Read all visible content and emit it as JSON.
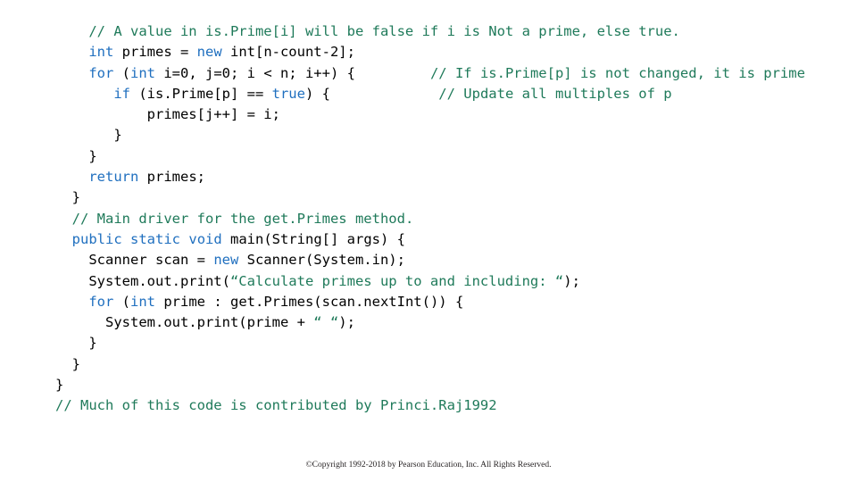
{
  "slide": {
    "code_lines": [
      [
        {
          "t": "    ",
          "c": "plain"
        },
        {
          "t": "// A value in is.Prime[i] will be false if i is Not a prime, else true.",
          "c": "cmt"
        }
      ],
      [
        {
          "t": "    ",
          "c": "plain"
        },
        {
          "t": "int",
          "c": "kw"
        },
        {
          "t": " primes = ",
          "c": "plain"
        },
        {
          "t": "new",
          "c": "kw"
        },
        {
          "t": " int[n-count-2];",
          "c": "plain"
        }
      ],
      [
        {
          "t": "    ",
          "c": "plain"
        },
        {
          "t": "for",
          "c": "kw"
        },
        {
          "t": " (",
          "c": "plain"
        },
        {
          "t": "int",
          "c": "kw"
        },
        {
          "t": " i=0, j=0; i < n; i++) {",
          "c": "plain"
        },
        {
          "t": "         ",
          "c": "plain"
        },
        {
          "t": "// If is.Prime[p] is not changed, it is prime",
          "c": "cmt"
        }
      ],
      [
        {
          "t": "       ",
          "c": "plain"
        },
        {
          "t": "if",
          "c": "kw"
        },
        {
          "t": " (is.Prime[p] == ",
          "c": "plain"
        },
        {
          "t": "true",
          "c": "kw"
        },
        {
          "t": ") {",
          "c": "plain"
        },
        {
          "t": "             ",
          "c": "plain"
        },
        {
          "t": "// Update all multiples of p",
          "c": "cmt"
        }
      ],
      [
        {
          "t": "           primes[j++] = i;",
          "c": "plain"
        }
      ],
      [
        {
          "t": "       }",
          "c": "plain"
        }
      ],
      [
        {
          "t": "    }",
          "c": "plain"
        }
      ],
      [
        {
          "t": "    ",
          "c": "plain"
        },
        {
          "t": "return",
          "c": "kw"
        },
        {
          "t": " primes;",
          "c": "plain"
        }
      ],
      [
        {
          "t": "  }",
          "c": "plain"
        }
      ],
      [
        {
          "t": "  ",
          "c": "plain"
        },
        {
          "t": "// Main driver for the get.Primes method.",
          "c": "cmt"
        }
      ],
      [
        {
          "t": "  ",
          "c": "plain"
        },
        {
          "t": "public",
          "c": "kw"
        },
        {
          "t": " ",
          "c": "plain"
        },
        {
          "t": "static",
          "c": "kw"
        },
        {
          "t": " ",
          "c": "plain"
        },
        {
          "t": "void",
          "c": "kw"
        },
        {
          "t": " main(String[] args) {",
          "c": "plain"
        }
      ],
      [
        {
          "t": "    Scanner scan = ",
          "c": "plain"
        },
        {
          "t": "new",
          "c": "kw"
        },
        {
          "t": " Scanner(System.in);",
          "c": "plain"
        }
      ],
      [
        {
          "t": "    System.out.print(",
          "c": "plain"
        },
        {
          "t": "“Calculate primes up to and including: “",
          "c": "str"
        },
        {
          "t": ");",
          "c": "plain"
        }
      ],
      [
        {
          "t": "    ",
          "c": "plain"
        },
        {
          "t": "for",
          "c": "kw"
        },
        {
          "t": " (",
          "c": "plain"
        },
        {
          "t": "int",
          "c": "kw"
        },
        {
          "t": " prime : get.Primes(scan.nextInt()) {",
          "c": "plain"
        }
      ],
      [
        {
          "t": "      System.out.print(prime + ",
          "c": "plain"
        },
        {
          "t": "“ “",
          "c": "str"
        },
        {
          "t": ");",
          "c": "plain"
        }
      ],
      [
        {
          "t": "    }",
          "c": "plain"
        }
      ],
      [
        {
          "t": "  }",
          "c": "plain"
        }
      ],
      [
        {
          "t": "}",
          "c": "plain"
        }
      ],
      [
        {
          "t": "// Much of this code is contributed by Princi.Raj1992",
          "c": "cmt"
        }
      ]
    ],
    "copyright": "©Copyright 1992-2018 by Pearson Education, Inc. All Rights Reserved.",
    "colors": {
      "keyword": "#1f6fbf",
      "comment": "#1f7a5a",
      "string": "#1f7a5a",
      "text": "#000000",
      "background": "#ffffff"
    }
  }
}
